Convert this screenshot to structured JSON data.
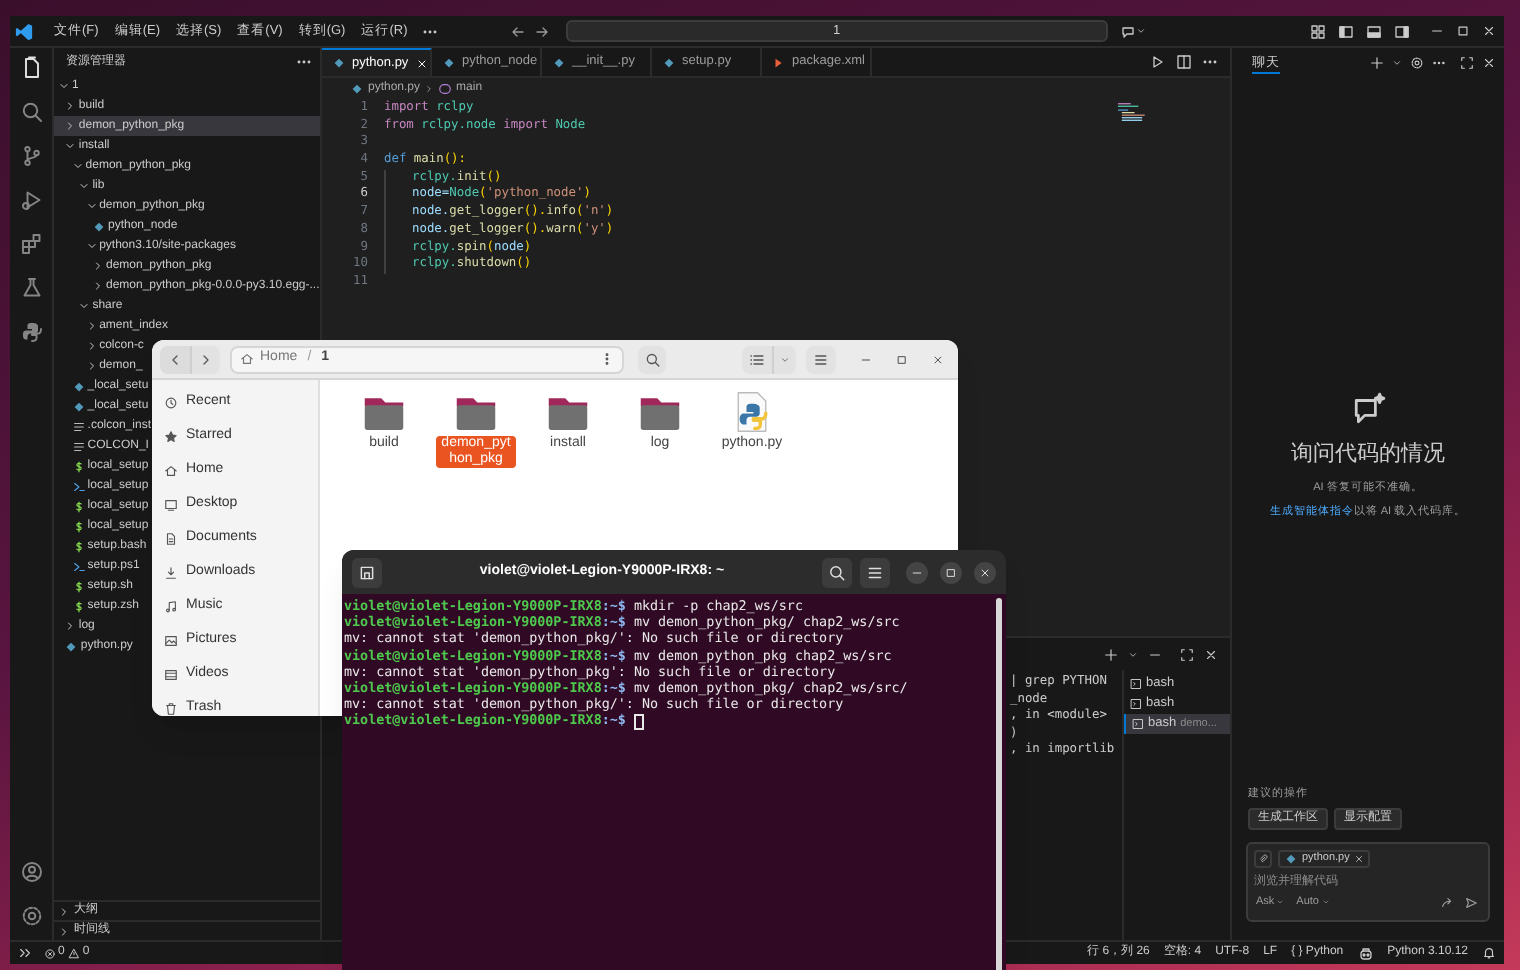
{
  "vscode": {
    "menu": [
      "文件(F)",
      "编辑(E)",
      "选择(S)",
      "查看(V)",
      "转到(G)",
      "运行(R)"
    ],
    "search": {
      "value": "1"
    },
    "explorer": {
      "title": "资源管理器",
      "tree": [
        {
          "label": "1",
          "kind": "folder",
          "expanded": true,
          "selected": false,
          "children": [
            {
              "label": "build",
              "kind": "folder",
              "expanded": false,
              "selected": false
            },
            {
              "label": "demon_python_pkg",
              "kind": "folder",
              "expanded": false,
              "selected": true
            },
            {
              "label": "install",
              "kind": "folder",
              "expanded": true,
              "selected": false,
              "children": [
                {
                  "label": "demon_python_pkg",
                  "kind": "folder",
                  "expanded": true,
                  "selected": false,
                  "children": [
                    {
                      "label": "lib",
                      "kind": "folder",
                      "expanded": true,
                      "selected": false,
                      "children": [
                        {
                          "label": "demon_python_pkg",
                          "kind": "folder",
                          "expanded": true,
                          "selected": false,
                          "children": [
                            {
                              "label": "python_node",
                              "kind": "python",
                              "selected": false
                            }
                          ]
                        },
                        {
                          "label": "python3.10/site-packages",
                          "kind": "folder",
                          "expanded": true,
                          "selected": false,
                          "children": [
                            {
                              "label": "demon_python_pkg",
                              "kind": "folder",
                              "expanded": false,
                              "selected": false
                            },
                            {
                              "label": "demon_python_pkg-0.0.0-py3.10.egg-...",
                              "kind": "folder",
                              "expanded": false,
                              "selected": false
                            }
                          ]
                        }
                      ]
                    },
                    {
                      "label": "share",
                      "kind": "folder",
                      "expanded": true,
                      "selected": false,
                      "children": [
                        {
                          "label": "ament_index",
                          "kind": "folder",
                          "expanded": false,
                          "selected": false
                        },
                        {
                          "label": "colcon-c",
                          "kind": "folder",
                          "expanded": false,
                          "selected": false
                        },
                        {
                          "label": "demon_",
                          "kind": "folder",
                          "expanded": false,
                          "selected": false
                        }
                      ]
                    }
                  ]
                },
                {
                  "label": "_local_setu",
                  "kind": "python",
                  "selected": false
                },
                {
                  "label": "_local_setu",
                  "kind": "python",
                  "selected": false
                },
                {
                  "label": ".colcon_inst",
                  "kind": "text",
                  "selected": false
                },
                {
                  "label": "COLCON_I",
                  "kind": "text",
                  "selected": false
                },
                {
                  "label": "local_setup",
                  "kind": "shell",
                  "selected": false
                },
                {
                  "label": "local_setup",
                  "kind": "powershell",
                  "selected": false
                },
                {
                  "label": "local_setup",
                  "kind": "shell",
                  "selected": false
                },
                {
                  "label": "local_setup",
                  "kind": "shell",
                  "selected": false
                },
                {
                  "label": "setup.bash",
                  "kind": "shell",
                  "selected": false
                },
                {
                  "label": "setup.ps1",
                  "kind": "powershell",
                  "selected": false
                },
                {
                  "label": "setup.sh",
                  "kind": "shell",
                  "selected": false
                },
                {
                  "label": "setup.zsh",
                  "kind": "shell",
                  "selected": false
                }
              ]
            },
            {
              "label": "log",
              "kind": "folder",
              "expanded": false,
              "selected": false
            },
            {
              "label": "python.py",
              "kind": "python",
              "selected": false
            }
          ]
        }
      ]
    },
    "sections": [
      {
        "label": "大纲",
        "expanded": false
      },
      {
        "label": "时间线",
        "expanded": false
      }
    ],
    "tabs": [
      {
        "label": "python.py",
        "kind": "python",
        "selected": true
      },
      {
        "label": "python_node",
        "kind": "python",
        "selected": false
      },
      {
        "label": "__init__.py",
        "kind": "python",
        "selected": false
      },
      {
        "label": "setup.py",
        "kind": "python",
        "selected": false
      },
      {
        "label": "package.xml",
        "kind": "xml",
        "selected": false
      }
    ],
    "breadcrumb": [
      "python.py",
      "main"
    ],
    "code": [
      {
        "number": "1",
        "current": false,
        "indent": false,
        "tokens": [
          {
            "text": "import",
            "kind": "control"
          },
          {
            "text": "rclpy",
            "kind": "module",
            "gap": true
          }
        ]
      },
      {
        "number": "2",
        "current": false,
        "indent": false,
        "tokens": [
          {
            "text": "from",
            "kind": "control"
          },
          {
            "text": "rclpy.node",
            "kind": "module",
            "gap": true
          },
          {
            "text": "import",
            "kind": "control",
            "gap": true
          },
          {
            "text": "Node",
            "kind": "module",
            "gap": true
          }
        ]
      },
      {
        "number": "3",
        "current": false,
        "indent": false
      },
      {
        "number": "4",
        "current": false,
        "indent": false,
        "tokens": [
          {
            "text": "def",
            "kind": "keyword"
          },
          {
            "text": "main",
            "kind": "function",
            "gap": true
          },
          {
            "text": "():",
            "kind": "bracket"
          }
        ]
      },
      {
        "number": "5",
        "current": false,
        "indent": true,
        "tokens": [
          {
            "text": "rclpy.",
            "kind": "module"
          },
          {
            "text": "init",
            "kind": "function"
          },
          {
            "text": "()",
            "kind": "bracket"
          }
        ]
      },
      {
        "number": "6",
        "current": true,
        "indent": true,
        "tokens": [
          {
            "text": "node=",
            "kind": "variable"
          },
          {
            "text": "Node",
            "kind": "module"
          },
          {
            "text": "(",
            "kind": "bracket"
          },
          {
            "text": "'python_node'",
            "kind": "string"
          },
          {
            "text": ")",
            "kind": "bracket"
          }
        ]
      },
      {
        "number": "7",
        "current": false,
        "indent": true,
        "tokens": [
          {
            "text": "node.",
            "kind": "variable"
          },
          {
            "text": "get_logger",
            "kind": "function"
          },
          {
            "text": "().",
            "kind": "bracket"
          },
          {
            "text": "info",
            "kind": "function"
          },
          {
            "text": "(",
            "kind": "bracket"
          },
          {
            "text": "'n'",
            "kind": "string"
          },
          {
            "text": ")",
            "kind": "bracket"
          }
        ]
      },
      {
        "number": "8",
        "current": false,
        "indent": true,
        "tokens": [
          {
            "text": "node.",
            "kind": "variable"
          },
          {
            "text": "get_logger",
            "kind": "function"
          },
          {
            "text": "().",
            "kind": "bracket"
          },
          {
            "text": "warn",
            "kind": "function"
          },
          {
            "text": "(",
            "kind": "bracket"
          },
          {
            "text": "'y'",
            "kind": "string"
          },
          {
            "text": ")",
            "kind": "bracket"
          }
        ]
      },
      {
        "number": "9",
        "current": false,
        "indent": true,
        "tokens": [
          {
            "text": "rclpy.",
            "kind": "module"
          },
          {
            "text": "spin",
            "kind": "function"
          },
          {
            "text": "(",
            "kind": "bracket"
          },
          {
            "text": "node",
            "kind": "variable"
          },
          {
            "text": ")",
            "kind": "bracket"
          }
        ]
      },
      {
        "number": "10",
        "current": false,
        "indent": true,
        "tokens": [
          {
            "text": "rclpy.",
            "kind": "module"
          },
          {
            "text": "shutdown",
            "kind": "function"
          },
          {
            "text": "()",
            "kind": "bracket"
          }
        ]
      },
      {
        "number": "11",
        "current": false,
        "indent": false
      }
    ],
    "panel": {
      "lines": [
        "| grep PYTHON",
        "_node",
        ", in <module>",
        ")",
        ", in importlib"
      ],
      "terminals": [
        {
          "label": "bash",
          "selected": false
        },
        {
          "label": "bash",
          "selected": false
        },
        {
          "label": "bash",
          "detail": "demo...",
          "selected": true
        }
      ]
    },
    "chat": {
      "tab": "聊天",
      "heading": "询问代码的情况",
      "note": "AI 答复可能不准确。",
      "link": "生成智能体指令",
      "link_suffix": "以将 AI 载入代码库。",
      "suggestions_title": "建议的操作",
      "suggestions": [
        "生成工作区",
        "显示配置"
      ],
      "attachment": "python.py",
      "placeholder": "浏览并理解代码",
      "mode": "Ask",
      "model": "Auto"
    },
    "status": {
      "errors": "0",
      "warnings": "0",
      "items": [
        "行 6，列 26",
        "空格: 4",
        "UTF-8",
        "LF",
        "{ } Python"
      ],
      "interpreter": "Python 3.10.12"
    }
  },
  "files": {
    "path": [
      "Home",
      "1"
    ],
    "separator": "/",
    "places": [
      {
        "label": "Recent",
        "kind": "recent"
      },
      {
        "label": "Starred",
        "kind": "starred"
      },
      {
        "label": "Home",
        "kind": "home"
      },
      {
        "label": "Desktop",
        "kind": "desktop"
      },
      {
        "label": "Documents",
        "kind": "documents"
      },
      {
        "label": "Downloads",
        "kind": "downloads"
      },
      {
        "label": "Music",
        "kind": "music"
      },
      {
        "label": "Pictures",
        "kind": "pictures"
      },
      {
        "label": "Videos",
        "kind": "videos"
      },
      {
        "label": "Trash",
        "kind": "trash"
      }
    ],
    "items": [
      {
        "label": "build",
        "kind": "folder",
        "selected": false
      },
      {
        "label": "demon_python_pkg",
        "kind": "folder",
        "selected": true
      },
      {
        "label": "install",
        "kind": "folder",
        "selected": false
      },
      {
        "label": "log",
        "kind": "folder",
        "selected": false
      },
      {
        "label": "python.py",
        "kind": "python",
        "selected": false
      }
    ]
  },
  "terminal": {
    "title": "violet@violet-Legion-Y9000P-IRX8: ~",
    "lines": [
      {
        "kind": "prompt",
        "user": "violet@violet-Legion-Y9000P-IRX8",
        "dir": ":~$",
        "command": "mkdir -p chap2_ws/src"
      },
      {
        "kind": "prompt",
        "user": "violet@violet-Legion-Y9000P-IRX8",
        "dir": ":~$",
        "command": "mv demon_python_pkg/ chap2_ws/src"
      },
      {
        "kind": "output",
        "text": "mv: cannot stat 'demon_python_pkg/': No such file or directory"
      },
      {
        "kind": "prompt",
        "user": "violet@violet-Legion-Y9000P-IRX8",
        "dir": ":~$",
        "command": "mv demon_python_pkg chap2_ws/src"
      },
      {
        "kind": "output",
        "text": "mv: cannot stat 'demon_python_pkg': No such file or directory"
      },
      {
        "kind": "prompt",
        "user": "violet@violet-Legion-Y9000P-IRX8",
        "dir": ":~$",
        "command": "mv demon_python_pkg/ chap2_ws/src/"
      },
      {
        "kind": "output",
        "text": "mv: cannot stat 'demon_python_pkg/': No such file or directory"
      },
      {
        "kind": "prompt",
        "user": "violet@violet-Legion-Y9000P-IRX8",
        "dir": ":~$",
        "cursor": true
      }
    ]
  }
}
